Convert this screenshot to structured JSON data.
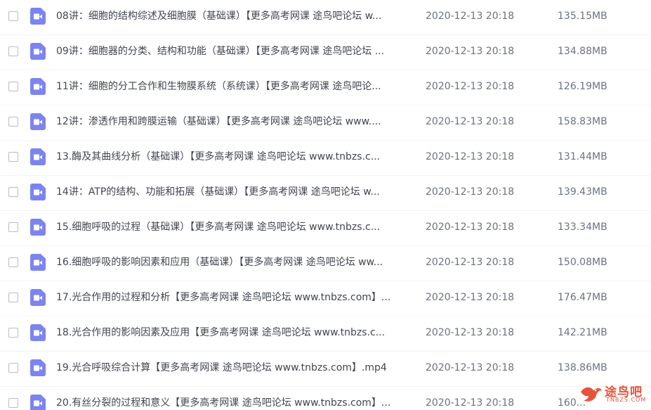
{
  "accent_color": "#7c84f0",
  "file_icon": "video-file-icon",
  "files": [
    {
      "name": "08讲：细胞的结构综述及细胞膜（基础课）【更多高考网课 途鸟吧论坛 w...",
      "date": "2020-12-13 20:18",
      "size": "135.15MB"
    },
    {
      "name": "09讲：细胞器的分类、结构和功能（基础课）【更多高考网课 途鸟吧论坛 ...",
      "date": "2020-12-13 20:18",
      "size": "134.88MB"
    },
    {
      "name": "11讲：细胞的分工合作和生物膜系统（系统课）【更多高考网课 途鸟吧论...",
      "date": "2020-12-13 20:18",
      "size": "126.19MB"
    },
    {
      "name": "12讲：渗透作用和跨膜运输（基础课）【更多高考网课 途鸟吧论坛 www....",
      "date": "2020-12-13 20:18",
      "size": "158.83MB"
    },
    {
      "name": "13.酶及其曲线分析（基础课）【更多高考网课 途鸟吧论坛 www.tnbzs.c...",
      "date": "2020-12-13 20:18",
      "size": "131.44MB"
    },
    {
      "name": "14讲：ATP的结构、功能和拓展（基础课）【更多高考网课 途鸟吧论坛 w...",
      "date": "2020-12-13 20:18",
      "size": "139.43MB"
    },
    {
      "name": "15.细胞呼吸的过程（基础课）【更多高考网课 途鸟吧论坛 www.tnbzs.c...",
      "date": "2020-12-13 20:18",
      "size": "133.34MB"
    },
    {
      "name": "16.细胞呼吸的影响因素和应用（基础课）【更多高考网课 途鸟吧论坛 ww...",
      "date": "2020-12-13 20:18",
      "size": "150.08MB"
    },
    {
      "name": "17.光合作用的过程和分析【更多高考网课 途鸟吧论坛 www.tnbzs.com】...",
      "date": "2020-12-13 20:18",
      "size": "176.47MB"
    },
    {
      "name": "18.光合作用的影响因素及应用【更多高考网课 途鸟吧论坛 www.tnbzs.c...",
      "date": "2020-12-13 20:18",
      "size": "142.21MB"
    },
    {
      "name": "19.光合呼吸综合计算【更多高考网课 途鸟吧论坛 www.tnbzs.com】.mp4",
      "date": "2020-12-13 20:18",
      "size": "138.86MB"
    },
    {
      "name": "20.有丝分裂的过程和意义【更多高考网课 途鸟吧论坛 www.tnbzs.com】...",
      "date": "2020-12-13 20:18",
      "size": "160..."
    }
  ],
  "watermark": {
    "text": "途鸟吧",
    "subtext": "TNBZS.COM",
    "color": "#e8533b"
  }
}
